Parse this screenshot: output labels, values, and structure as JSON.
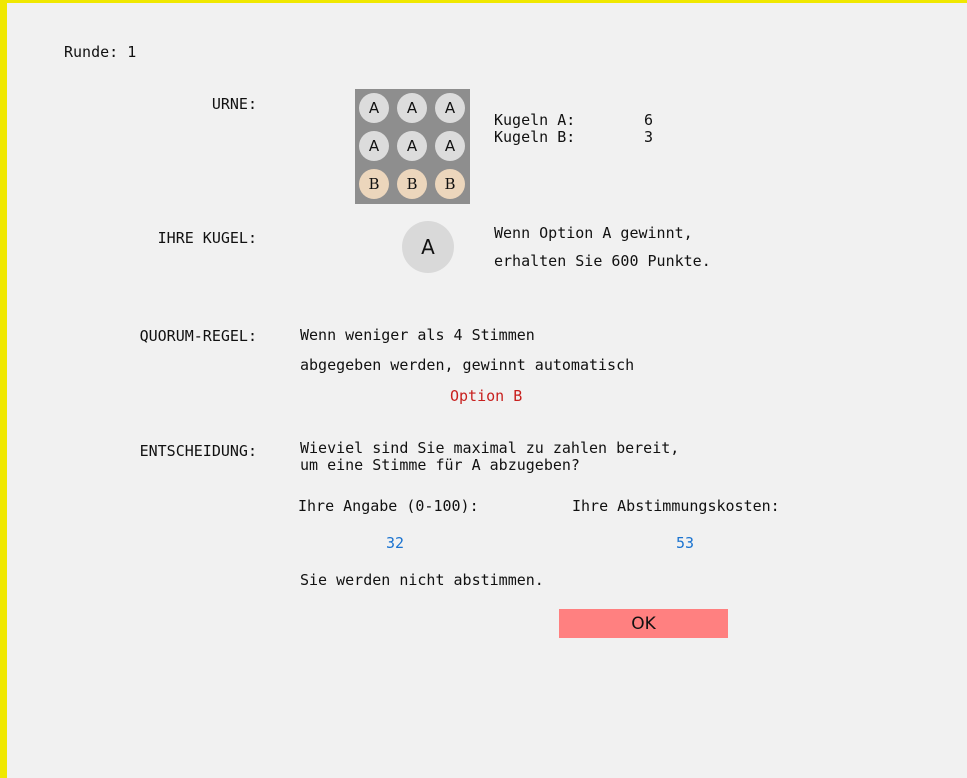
{
  "round": {
    "label": "Runde: 1"
  },
  "urn": {
    "label": "URNE:",
    "rows": [
      [
        "A",
        "A",
        "A"
      ],
      [
        "A",
        "A",
        "A"
      ],
      [
        "B",
        "B",
        "B"
      ]
    ],
    "count_a_label": "Kugeln A:",
    "count_a_value": "6",
    "count_b_label": "Kugeln B:",
    "count_b_value": "3"
  },
  "my_ball": {
    "label": "IHRE KUGEL:",
    "letter": "A",
    "text_line1": "Wenn Option A gewinnt,",
    "text_line2": "erhalten Sie 600 Punkte."
  },
  "quorum": {
    "label": "QUORUM-REGEL:",
    "line1": "Wenn weniger als 4 Stimmen",
    "line2": "abgegeben werden, gewinnt automatisch",
    "option": "Option B"
  },
  "decision": {
    "label": "ENTSCHEIDUNG:",
    "question_line1": "Wieviel sind Sie maximal zu zahlen bereit,",
    "question_line2": "um eine Stimme  für A abzugeben?",
    "input_label": "Ihre Angabe (0-100):",
    "input_value": "32",
    "cost_label": "Ihre Abstimmungskosten:",
    "cost_value": "53",
    "result": "Sie werden nicht abstimmen."
  },
  "ok_button": {
    "label": "OK"
  },
  "colors": {
    "frame_border": "#f0e800",
    "background": "#f1f1f1",
    "urn_bg": "#8e8e8e",
    "ball_a": "#dcdcdc",
    "ball_b": "#ecd6bc",
    "option_text": "#c8201e",
    "value_text": "#1a73d0",
    "ok_button": "#ff8080"
  }
}
